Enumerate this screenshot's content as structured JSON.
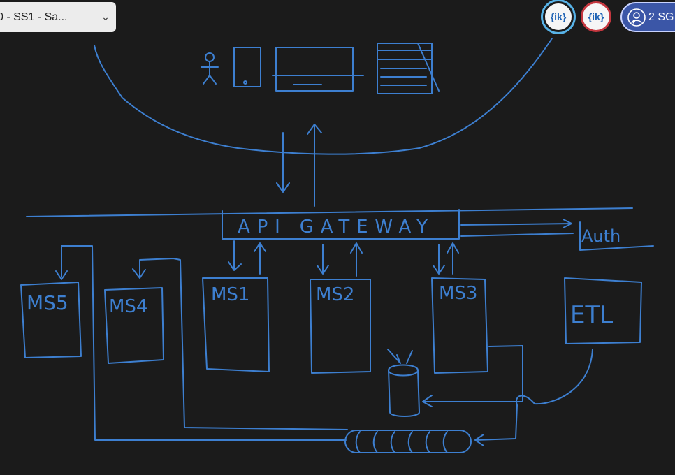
{
  "tab": {
    "title": "0 - SS1 - Sa...",
    "chevron_icon": "chevron-down-icon"
  },
  "participants": [
    {
      "label": "{ik}",
      "ring_color": "#58b3e8"
    },
    {
      "label": "{ik}",
      "ring_color": "#c5373f"
    }
  ],
  "session_pill": {
    "label": "2 SG",
    "icon": "person-add-icon",
    "color": "#3b56a7"
  },
  "whiteboard": {
    "ink_color": "#3d7fd0",
    "labels": {
      "gateway": "API GATEWAY",
      "auth": "Auth",
      "ms1": "MS1",
      "ms2": "MS2",
      "ms3": "MS3",
      "ms4": "MS4",
      "ms5": "MS5",
      "etl": "ETL"
    }
  }
}
